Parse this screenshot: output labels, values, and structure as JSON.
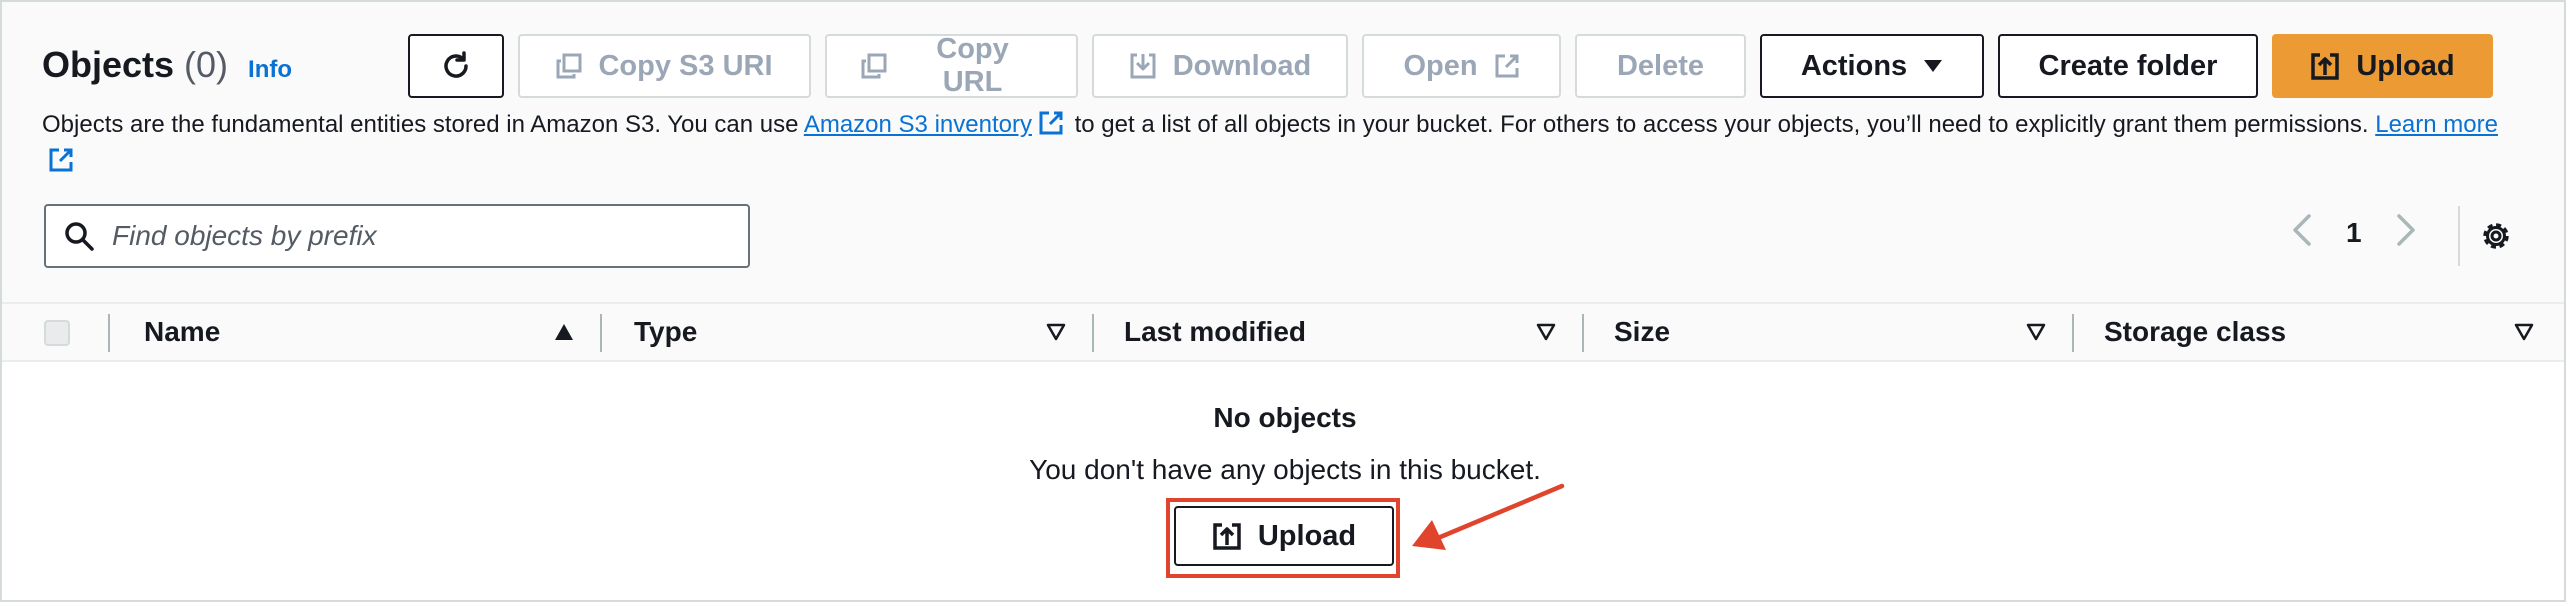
{
  "header": {
    "title": "Objects",
    "count": "(0)",
    "info_label": "Info"
  },
  "toolbar": {
    "copy_s3_uri": "Copy S3 URI",
    "copy_url": "Copy URL",
    "download": "Download",
    "open": "Open",
    "delete": "Delete",
    "actions": "Actions",
    "create_folder": "Create folder",
    "upload": "Upload"
  },
  "description": {
    "text_before": "Objects are the fundamental entities stored in Amazon S3. You can use ",
    "inventory_link": "Amazon S3 inventory",
    "text_after": " to get a list of all objects in your bucket. For others to access your objects, you’ll need to explicitly grant them permissions. ",
    "learn_more": "Learn more"
  },
  "search": {
    "placeholder": "Find objects by prefix"
  },
  "pagination": {
    "current_page": "1"
  },
  "table": {
    "columns": [
      "Name",
      "Type",
      "Last modified",
      "Size",
      "Storage class"
    ]
  },
  "empty_state": {
    "title": "No objects",
    "message": "You don't have any objects in this bucket.",
    "upload_label": "Upload"
  },
  "colors": {
    "primary_button": "#ec9a33",
    "link": "#0972d3",
    "annotation": "#e0442d"
  },
  "icons": [
    "refresh-icon",
    "copy-icon",
    "download-icon",
    "external-link-icon",
    "caret-down-icon",
    "upload-icon",
    "search-icon",
    "chevron-left-icon",
    "chevron-right-icon",
    "gear-icon",
    "sort-ascending-icon",
    "sort-descending-icon"
  ]
}
